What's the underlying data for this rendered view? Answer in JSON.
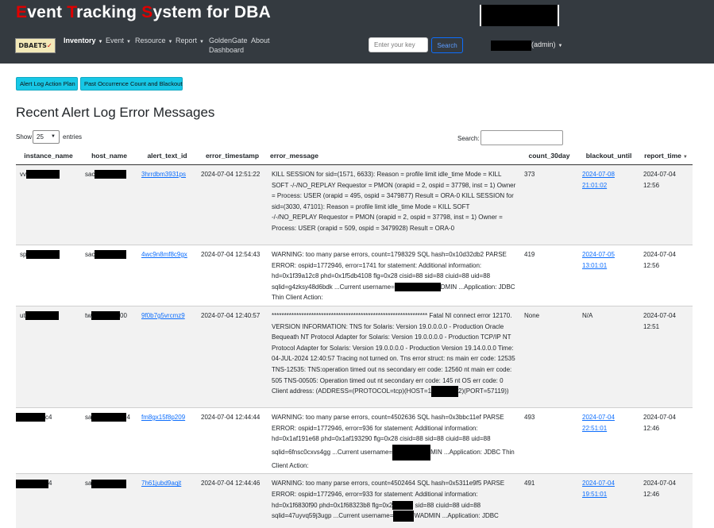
{
  "app": {
    "title_parts": [
      {
        "cap": "E",
        "rest": "vent "
      },
      {
        "cap": "T",
        "rest": "racking "
      },
      {
        "cap": "S",
        "rest": "ystem for DBA"
      }
    ],
    "logo_text": "DBAETS",
    "accent_color": "#e00000"
  },
  "nav": {
    "inventory": "Inventory",
    "event": "Event",
    "resource": "Resource",
    "report": "Report",
    "goldengate_line1": "GoldenGate",
    "goldengate_line2": "Dashboard",
    "about": "About"
  },
  "header_search": {
    "placeholder": "Enter your key",
    "button": "Search"
  },
  "user": {
    "role_label": "(admin)"
  },
  "actions": {
    "alert_plan": "Alert Log Action Plan",
    "past_occurrence": "Past Occurrence Count and Blackout"
  },
  "page": {
    "title": "Recent Alert Log Error Messages"
  },
  "table_controls": {
    "show": "Show",
    "page_size": "25",
    "entries": "entries",
    "search": "Search:"
  },
  "table": {
    "headers": [
      "instance_name",
      "host_name",
      "alert_text_id",
      "error_timestamp",
      "error_message",
      "count_30day",
      "blackout_until",
      "report_time"
    ],
    "rows": [
      {
        "instance_prefix": "vv",
        "host_prefix": "sac",
        "host_suffix": "",
        "alert_id": "3hrrdbm3931ps",
        "timestamp": "2024-07-04 12:51:22",
        "message": "KILL SESSION for sid=(1571, 6633): Reason = profile limit idle_time Mode = KILL SOFT -/-/NO_REPLAY Requestor = PMON (orapid = 2, ospid = 37798, inst = 1) Owner = Process: USER (orapid = 495, ospid = 3479877) Result = ORA-0 KILL SESSION for sid=(3030, 47101): Reason = profile limit idle_time Mode = KILL SOFT -/-/NO_REPLAY Requestor = PMON (orapid = 2, ospid = 37798, inst = 1) Owner = Process: USER (orapid = 509, ospid = 3479928) Result = ORA-0",
        "count": "373",
        "blackout_line1": "2024-07-08",
        "blackout_line2": "21:01:02",
        "report_line1": "2024-07-04",
        "report_line2": "12:56"
      },
      {
        "instance_prefix": "sp",
        "host_prefix": "sac",
        "host_suffix": "",
        "alert_id": "4wc9n8mf8c9gx",
        "timestamp": "2024-07-04 12:54:43",
        "message_before": "WARNING: too many parse errors, count=1798329 SQL hash=0x10d32db2 PARSE ERROR: ospid=1772946, error=1741 for statement: Additional information: hd=0x1f39a12c8 phd=0x1f5db4108 flg=0x28 cisid=88 sid=88 ciuid=88 uid=88 sqlid=g4zksy48d6bdk ...Current username=",
        "message_after": "DMIN ...Application: JDBC Thin Client Action:",
        "count": "419",
        "blackout_line1": "2024-07-05",
        "blackout_line2": "13:01:01",
        "report_line1": "2024-07-04",
        "report_line2": "12:56"
      },
      {
        "instance_prefix": "ut",
        "host_prefix": "tw",
        "host_suffix": "00",
        "alert_id": "9f0b7g5vrcmz9",
        "timestamp": "2024-07-04 12:40:57",
        "message_before": "*************************************************************** Fatal NI connect error 12170. VERSION INFORMATION: TNS for Solaris: Version 19.0.0.0.0 - Production Oracle Bequeath NT Protocol Adapter for Solaris: Version 19.0.0.0.0 - Production TCP/IP NT Protocol Adapter for Solaris: Version 19.0.0.0.0 - Production Version 19.14.0.0.0 Time: 04-JUL-2024 12:40:57 Tracing not turned on. Tns error struct: ns main err code: 12535 TNS-12535: TNS:operation timed out ns secondary err code: 12560 nt main err code: 505 TNS-00505: Operation timed out nt secondary err code: 145 nt OS err code: 0 Client address: (ADDRESS=(PROTOCOL=tcp)(HOST=1",
        "message_after": "2)(PORT=57119))",
        "count": "None",
        "blackout_line1": "N/A",
        "blackout_line2": "",
        "report_line1": "2024-07-04",
        "report_line2": "12:51"
      },
      {
        "instance_prefix": "",
        "instance_suffix": "c4",
        "host_prefix": "sa",
        "host_suffix": "4",
        "alert_id": "fm8gx15f8p209",
        "timestamp": "2024-07-04 12:44:44",
        "message_before": "WARNING: too many parse errors, count=4502636 SQL hash=0x3bbc11ef PARSE ERROR: ospid=1772946, error=936 for statement: Additional information: hd=0x1af191e68 phd=0x1af193290 flg=0x28 cisid=88 sid=88 ciuid=88 uid=88 sqlid=6fnsc0cxvs4gg ...Current username=",
        "message_after": "MIN ...Application: JDBC Thin Client Action:",
        "count": "493",
        "blackout_line1": "2024-07-04",
        "blackout_line2": "22:51:01",
        "report_line1": "2024-07-04",
        "report_line2": "12:46"
      },
      {
        "instance_prefix": "",
        "instance_suffix": "4",
        "host_prefix": "sa",
        "host_suffix": "",
        "alert_id": "7h61jubd9aqjt",
        "timestamp": "2024-07-04 12:44:46",
        "message_before": "WARNING: too many parse errors, count=4502464 SQL hash=0x5311e9f5 PARSE ERROR: ospid=1772946, error=933 for statement: Additional information: hd=0x1f6830f90 phd=0x1f68323b8 flg=0x2",
        "message_middle": " sid=88 ciuid=88 uid=88 sqlid=47uyvq59j3ugp ...Current username=",
        "message_after": "WADMIN ...Application: JDBC",
        "count": "491",
        "blackout_line1": "2024-07-04",
        "blackout_line2": "19:51:01",
        "report_line1": "2024-07-04",
        "report_line2": "12:46"
      }
    ]
  }
}
